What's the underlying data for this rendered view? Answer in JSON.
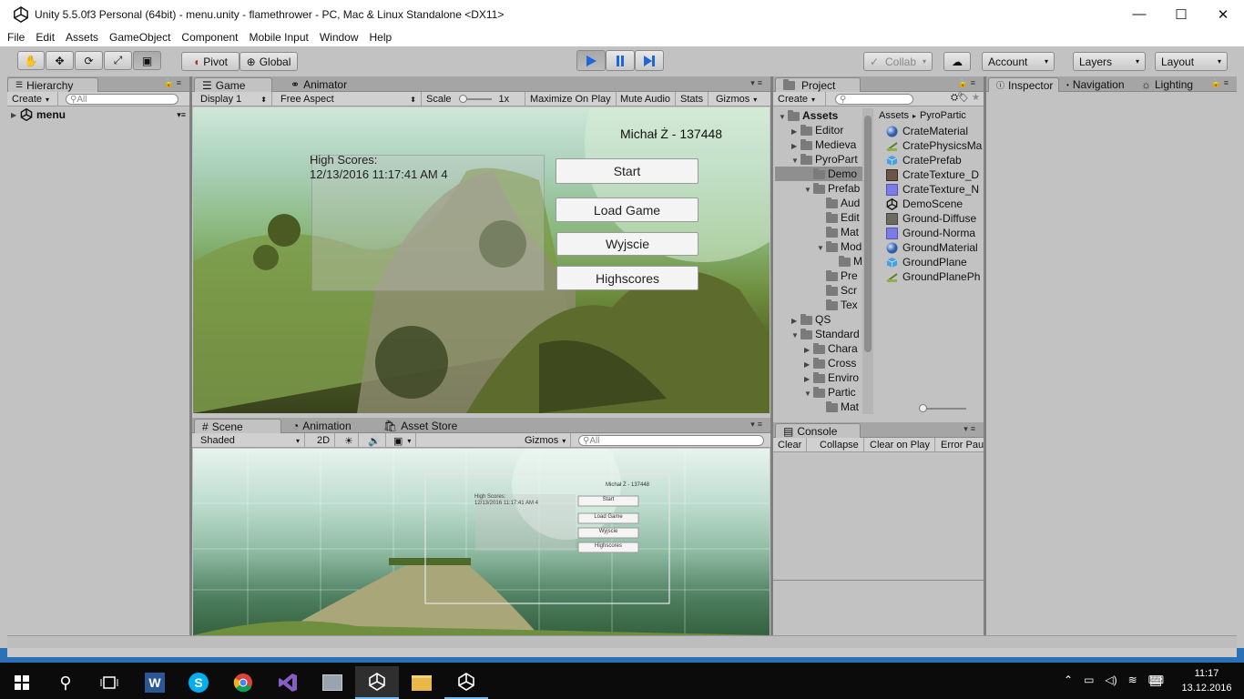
{
  "window": {
    "title": "Unity 5.5.0f3 Personal (64bit) - menu.unity - flamethrower - PC, Mac & Linux Standalone <DX11>",
    "minimize": "—",
    "maximize": "☐",
    "close": "✕"
  },
  "menu": [
    "File",
    "Edit",
    "Assets",
    "GameObject",
    "Component",
    "Mobile Input",
    "Window",
    "Help"
  ],
  "toolbar": {
    "pivot": "Pivot",
    "global": "Global",
    "collab": "Collab",
    "account": "Account",
    "layers": "Layers",
    "layout": "Layout"
  },
  "hierarchy": {
    "tab": "Hierarchy",
    "create": "Create",
    "search_placeholder": "All",
    "root": "menu"
  },
  "game": {
    "tabs": [
      "Game",
      "Animator"
    ],
    "display": "Display 1",
    "aspect": "Free Aspect",
    "scale_label": "Scale",
    "scale_value": "1x",
    "maximize": "Maximize On Play",
    "mute": "Mute Audio",
    "stats": "Stats",
    "gizmos": "Gizmos",
    "player": "Michał Ż - 137448",
    "scores_title": "High Scores:",
    "scores_entry": "12/13/2016 11:17:41 AM 4",
    "buttons": [
      "Start",
      "Load Game",
      "Wyjscie",
      "Highscores"
    ]
  },
  "scene": {
    "tabs": [
      "Scene",
      "Animation",
      "Asset Store"
    ],
    "shading": "Shaded",
    "mode2d": "2D",
    "gizmos": "Gizmos",
    "search_placeholder": "All"
  },
  "project": {
    "tab": "Project",
    "create": "Create",
    "tree": [
      {
        "label": "Assets",
        "indent": 0,
        "arrow": "▼",
        "bold": true
      },
      {
        "label": "Editor",
        "indent": 1,
        "arrow": "▶"
      },
      {
        "label": "Medieva",
        "indent": 1,
        "arrow": "▶"
      },
      {
        "label": "PyroPart",
        "indent": 1,
        "arrow": "▼"
      },
      {
        "label": "Demo",
        "indent": 2,
        "arrow": "",
        "selected": true
      },
      {
        "label": "Prefab",
        "indent": 2,
        "arrow": "▼"
      },
      {
        "label": "Aud",
        "indent": 3,
        "arrow": ""
      },
      {
        "label": "Edit",
        "indent": 3,
        "arrow": ""
      },
      {
        "label": "Mat",
        "indent": 3,
        "arrow": ""
      },
      {
        "label": "Mod",
        "indent": 3,
        "arrow": "▼"
      },
      {
        "label": "M",
        "indent": 4,
        "arrow": ""
      },
      {
        "label": "Pre",
        "indent": 3,
        "arrow": ""
      },
      {
        "label": "Scr",
        "indent": 3,
        "arrow": ""
      },
      {
        "label": "Tex",
        "indent": 3,
        "arrow": ""
      },
      {
        "label": "QS",
        "indent": 1,
        "arrow": "▶"
      },
      {
        "label": "Standard",
        "indent": 1,
        "arrow": "▼"
      },
      {
        "label": "Chara",
        "indent": 2,
        "arrow": "▶"
      },
      {
        "label": "Cross",
        "indent": 2,
        "arrow": "▶"
      },
      {
        "label": "Enviro",
        "indent": 2,
        "arrow": "▶"
      },
      {
        "label": "Partic",
        "indent": 2,
        "arrow": "▼"
      },
      {
        "label": "Mat",
        "indent": 3,
        "arrow": ""
      }
    ],
    "breadcrumb": [
      "Assets",
      "PyroPartic"
    ],
    "assets": [
      {
        "label": "CrateMaterial",
        "icon": "sphere"
      },
      {
        "label": "CratePhysicsMa",
        "icon": "physics"
      },
      {
        "label": "CratePrefab",
        "icon": "prefab"
      },
      {
        "label": "CrateTexture_D",
        "icon": "texture-brown"
      },
      {
        "label": "CrateTexture_N",
        "icon": "texture-blue"
      },
      {
        "label": "DemoScene",
        "icon": "unity"
      },
      {
        "label": "Ground-Diffuse",
        "icon": "texture-grey"
      },
      {
        "label": "Ground-Norma",
        "icon": "texture-blue"
      },
      {
        "label": "GroundMaterial",
        "icon": "sphere"
      },
      {
        "label": "GroundPlane",
        "icon": "prefab"
      },
      {
        "label": "GroundPlanePh",
        "icon": "physics"
      }
    ]
  },
  "console": {
    "tab": "Console",
    "buttons": [
      "Clear",
      "Collapse",
      "Clear on Play",
      "Error Pau"
    ]
  },
  "inspector": {
    "tabs": [
      "Inspector",
      "Navigation",
      "Lighting"
    ]
  },
  "taskbar": {
    "time": "11:17",
    "date": "13.12.2016"
  }
}
